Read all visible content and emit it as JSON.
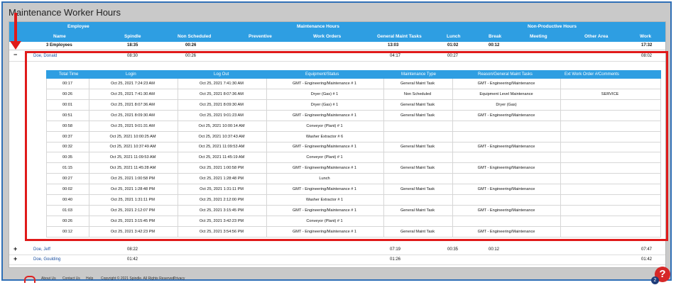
{
  "title": "Maintenance Worker Hours",
  "header": {
    "group_employee": "Employee",
    "group_maintenance": "Maintenance Hours",
    "group_nonproductive": "Non-Productive Hours",
    "col_name": "Name",
    "col_spindle": "Spindle",
    "col_nonscheduled": "Non Scheduled",
    "col_preventive": "Preventive",
    "col_workorders": "Work Orders",
    "col_general": "General Maint Tasks",
    "col_lunch": "Lunch",
    "col_break": "Break",
    "col_meeting": "Meeting",
    "col_otherarea": "Other Area",
    "col_work": "Work"
  },
  "totals": {
    "employees": "3 Employees",
    "spindle": "18:35",
    "nonscheduled": "00:26",
    "general": "13:03",
    "lunch": "01:02",
    "break": "00:12",
    "work": "17:32"
  },
  "employees": [
    {
      "toggle": "−",
      "name": "Doe, Donald",
      "spindle": "08:30",
      "nonscheduled": "00:26",
      "general": "04:17",
      "lunch": "00:27",
      "break": "",
      "work": "08:02"
    },
    {
      "toggle": "+",
      "name": "Doe, Jeff",
      "spindle": "08:22",
      "nonscheduled": "",
      "general": "07:19",
      "lunch": "00:35",
      "break": "00:12",
      "work": "07:47"
    },
    {
      "toggle": "+",
      "name": "Doe, Goulding",
      "spindle": "01:42",
      "nonscheduled": "",
      "general": "01:26",
      "lunch": "",
      "break": "",
      "work": "01:42"
    }
  ],
  "detail_header": {
    "total_time": "Total Time",
    "login": "Login",
    "logout": "Log Out",
    "equipment": "Equipment/Status",
    "maint_type": "Maintenance Type",
    "reason": "Reason/General Maint Tasks",
    "ext": "Ext Work Order #/Comments"
  },
  "details": [
    {
      "t": "00:17",
      "in": "Oct 25, 2021 7:24:23 AM",
      "out": "Oct 25, 2021 7:41:30 AM",
      "eq": "GMT - Engineering/Maintenance # 1",
      "type": "General Maint Task",
      "reason": "GMT - Engineering/Maintenance",
      "ext": ""
    },
    {
      "t": "00:26",
      "in": "Oct 25, 2021 7:41:30 AM",
      "out": "Oct 25, 2021 8:07:36 AM",
      "eq": "Dryer (Gas) # 1",
      "type": "Non Scheduled",
      "reason": "Equipment Level Maintenance",
      "ext": "SERVICE"
    },
    {
      "t": "00:01",
      "in": "Oct 25, 2021 8:07:36 AM",
      "out": "Oct 25, 2021 8:09:30 AM",
      "eq": "Dryer (Gas) # 1",
      "type": "General Maint Task",
      "reason": "Dryer (Gas)",
      "ext": ""
    },
    {
      "t": "00:51",
      "in": "Oct 25, 2021 8:09:30 AM",
      "out": "Oct 25, 2021 9:01:23 AM",
      "eq": "GMT - Engineering/Maintenance # 1",
      "type": "General Maint Task",
      "reason": "GMT - Engineering/Maintenance",
      "ext": ""
    },
    {
      "t": "00:58",
      "in": "Oct 25, 2021 9:01:31 AM",
      "out": "Oct 25, 2021 10:00:14 AM",
      "eq": "Conveyor (Plant) # 1",
      "type": "",
      "reason": "",
      "ext": ""
    },
    {
      "t": "00:37",
      "in": "Oct 25, 2021 10:00:25 AM",
      "out": "Oct 25, 2021 10:37:43 AM",
      "eq": "Washer Extractor # 6",
      "type": "",
      "reason": "",
      "ext": ""
    },
    {
      "t": "00:32",
      "in": "Oct 25, 2021 10:37:49 AM",
      "out": "Oct 25, 2021 11:09:53 AM",
      "eq": "GMT - Engineering/Maintenance # 1",
      "type": "General Maint Task",
      "reason": "GMT - Engineering/Maintenance",
      "ext": ""
    },
    {
      "t": "00:35",
      "in": "Oct 25, 2021 11:09:53 AM",
      "out": "Oct 25, 2021 11:45:19 AM",
      "eq": "Conveyor (Plant) # 1",
      "type": "",
      "reason": "",
      "ext": ""
    },
    {
      "t": "01:15",
      "in": "Oct 25, 2021 11:45:28 AM",
      "out": "Oct 25, 2021 1:00:58 PM",
      "eq": "GMT - Engineering/Maintenance # 1",
      "type": "General Maint Task",
      "reason": "GMT - Engineering/Maintenance",
      "ext": ""
    },
    {
      "t": "00:27",
      "in": "Oct 25, 2021 1:00:58 PM",
      "out": "Oct 25, 2021 1:28:48 PM",
      "eq": "Lunch",
      "type": "",
      "reason": "",
      "ext": ""
    },
    {
      "t": "00:02",
      "in": "Oct 25, 2021 1:28:48 PM",
      "out": "Oct 25, 2021 1:31:11 PM",
      "eq": "GMT - Engineering/Maintenance # 1",
      "type": "General Maint Task",
      "reason": "GMT - Engineering/Maintenance",
      "ext": ""
    },
    {
      "t": "00:40",
      "in": "Oct 25, 2021 1:31:11 PM",
      "out": "Oct 25, 2021 2:12:00 PM",
      "eq": "Washer Extractor # 1",
      "type": "",
      "reason": "",
      "ext": ""
    },
    {
      "t": "01:03",
      "in": "Oct 25, 2021 2:12:07 PM",
      "out": "Oct 25, 2021 3:15:45 PM",
      "eq": "GMT - Engineering/Maintenance # 1",
      "type": "General Maint Task",
      "reason": "GMT - Engineering/Maintenance",
      "ext": ""
    },
    {
      "t": "00:26",
      "in": "Oct 25, 2021 3:15:45 PM",
      "out": "Oct 25, 2021 3:42:23 PM",
      "eq": "Conveyor (Plant) # 1",
      "type": "",
      "reason": "",
      "ext": ""
    },
    {
      "t": "00:12",
      "in": "Oct 25, 2021 3:42:23 PM",
      "out": "Oct 25, 2021 3:54:56 PM",
      "eq": "GMT - Engineering/Maintenance # 1",
      "type": "General Maint Task",
      "reason": "GMT - Engineering/Maintenance",
      "ext": ""
    }
  ],
  "footer": {
    "about": "About Us",
    "contact": "Contact Us",
    "help": "Help",
    "copyright": "Copyright © 2021 Spindle. All Rights Reserved.",
    "privacy": "Privacy"
  },
  "help_button": "?",
  "notification_count": "2",
  "colors": {
    "header": "#2e9ee2",
    "highlight": "#e01a1a",
    "link": "#1a4fa0"
  }
}
